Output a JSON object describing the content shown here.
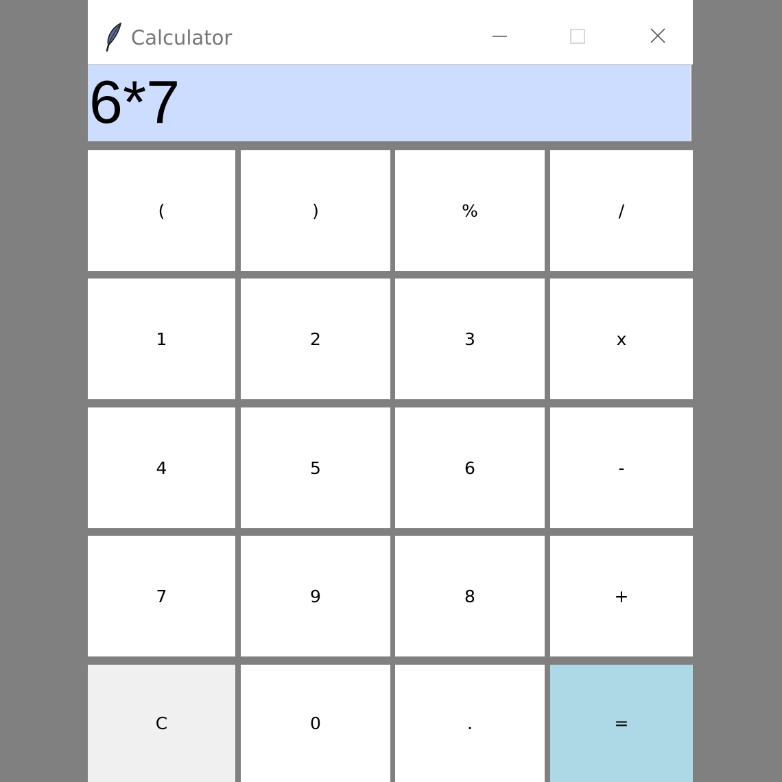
{
  "window": {
    "title": "Calculator",
    "icon": "feather-icon",
    "controls": {
      "minimize": "minimize-icon",
      "maximize": "maximize-icon",
      "close": "close-icon"
    }
  },
  "display": {
    "value": "6*7",
    "background": "#ccddff"
  },
  "keys": {
    "open_paren": "(",
    "close_paren": ")",
    "percent": "%",
    "divide": "/",
    "one": "1",
    "two": "2",
    "three": "3",
    "multiply": "x",
    "four": "4",
    "five": "5",
    "six": "6",
    "minus": "-",
    "seven": "7",
    "nine": "9",
    "eight": "8",
    "plus": "+",
    "clear": "C",
    "zero": "0",
    "decimal": ".",
    "equals": "="
  },
  "colors": {
    "background": "#808080",
    "key": "#ffffff",
    "clear_key": "#f0f0f0",
    "equals_key": "#add8e6"
  }
}
